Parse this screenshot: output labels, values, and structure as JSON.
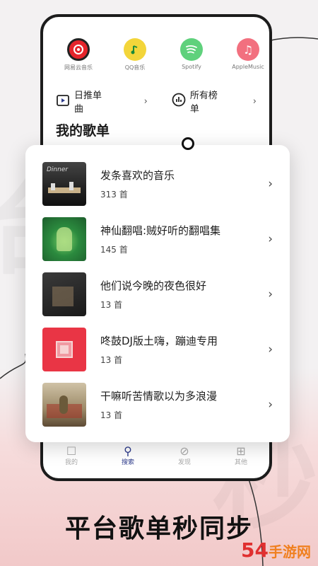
{
  "apps": [
    {
      "label": "网易云音乐",
      "color": "#e5242b",
      "icon": "netease-icon"
    },
    {
      "label": "QQ音乐",
      "color": "#f3d53a",
      "icon": "qqmusic-icon"
    },
    {
      "label": "Spotify",
      "color": "#5fd17c",
      "icon": "spotify-icon"
    },
    {
      "label": "AppleMusic",
      "color": "#f2707f",
      "icon": "applemusic-icon"
    }
  ],
  "quick": {
    "daily": "日推单曲",
    "charts": "所有榜单"
  },
  "section_title": "我的歌单",
  "playlists": [
    {
      "title": "发条喜欢的音乐",
      "count": "313 首",
      "cover_text": "Dinner"
    },
    {
      "title": "神仙翻唱:贼好听的翻唱集",
      "count": "145 首"
    },
    {
      "title": "他们说今晚的夜色很好",
      "count": "13 首"
    },
    {
      "title": "咚鼓DJ版土嗨，蹦迪专用",
      "count": "13 首"
    },
    {
      "title": "干嘛听苦情歌以为多浪漫",
      "count": "13 首"
    }
  ],
  "tabs": [
    {
      "label": "我的",
      "icon": "user-icon"
    },
    {
      "label": "搜索",
      "icon": "search-icon"
    },
    {
      "label": "发现",
      "icon": "compass-icon"
    },
    {
      "label": "其他",
      "icon": "grid-icon"
    }
  ],
  "headline": "平台歌单秒同步",
  "watermark": {
    "a": "54",
    "b": "手游网"
  }
}
